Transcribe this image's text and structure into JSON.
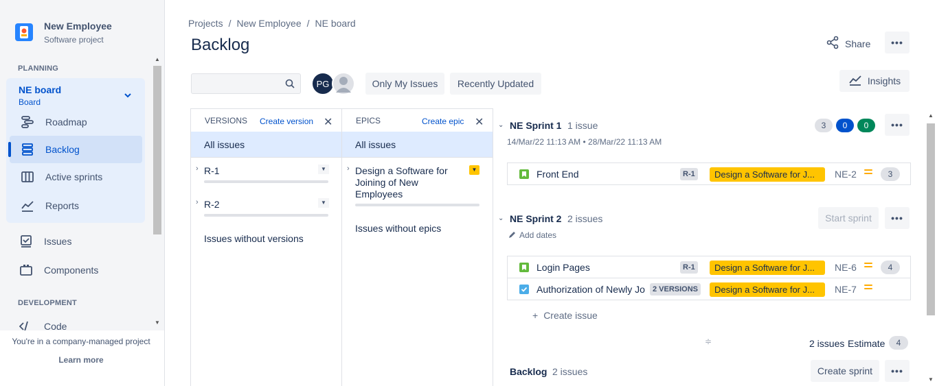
{
  "sidebar": {
    "project_name": "New Employee",
    "project_type": "Software project",
    "planning_label": "PLANNING",
    "board_name": "NE board",
    "board_sub": "Board",
    "items": [
      {
        "label": "Roadmap",
        "icon": "roadmap-icon"
      },
      {
        "label": "Backlog",
        "icon": "backlog-icon"
      },
      {
        "label": "Active sprints",
        "icon": "active-sprints-icon"
      },
      {
        "label": "Reports",
        "icon": "reports-icon"
      },
      {
        "label": "Issues",
        "icon": "issues-icon"
      },
      {
        "label": "Components",
        "icon": "components-icon"
      },
      {
        "label": "Code",
        "icon": "code-icon"
      }
    ],
    "development_label": "DEVELOPMENT",
    "footer_text": "You're in a company-managed project",
    "learn_more": "Learn more"
  },
  "breadcrumb": [
    "Projects",
    "New Employee",
    "NE board"
  ],
  "breadcrumb_sep": "/",
  "page_title": "Backlog",
  "header": {
    "share_label": "Share",
    "more": "•••",
    "insights_label": "Insights"
  },
  "filters": {
    "search_placeholder": "",
    "avatar_initials": "PG",
    "only_my_issues": "Only My Issues",
    "recently_updated": "Recently Updated"
  },
  "versions_panel": {
    "title": "VERSIONS",
    "create": "Create version",
    "all": "All issues",
    "items": [
      "R-1",
      "R-2"
    ],
    "without": "Issues without versions"
  },
  "epics_panel": {
    "title": "EPICS",
    "create": "Create epic",
    "all": "All issues",
    "epic_name": "Design a Software for Joining of New Employees",
    "without": "Issues without epics"
  },
  "sprint1": {
    "name": "NE Sprint 1",
    "count": "1 issue",
    "dates": "14/Mar/22 11:13 AM • 28/Mar/22 11:13 AM",
    "status_counts": [
      "3",
      "0",
      "0"
    ],
    "issues": [
      {
        "summary": "Front End",
        "version": "R-1",
        "epic": "Design a Software for J...",
        "key": "NE-2",
        "estimate": "3",
        "type": "story"
      }
    ]
  },
  "sprint2": {
    "name": "NE Sprint 2",
    "count": "2 issues",
    "start_sprint": "Start sprint",
    "add_dates": "Add dates",
    "issues": [
      {
        "summary": "Login Pages",
        "version": "R-1",
        "epic": "Design a Software for J...",
        "key": "NE-6",
        "estimate": "4",
        "type": "story"
      },
      {
        "summary": "Authorization of Newly Jo",
        "version": "2 VERSIONS",
        "epic": "Design a Software for J...",
        "key": "NE-7",
        "estimate": "",
        "type": "task"
      }
    ],
    "create_issue": "Create issue",
    "footer_count": "2 issues",
    "footer_estimate_label": "Estimate",
    "footer_estimate": "4"
  },
  "backlog": {
    "name": "Backlog",
    "count": "2 issues",
    "create_sprint": "Create sprint"
  },
  "colors": {
    "accent": "#0052cc",
    "epic": "#ffc400",
    "story": "#63ba3c",
    "task": "#4bade8"
  }
}
